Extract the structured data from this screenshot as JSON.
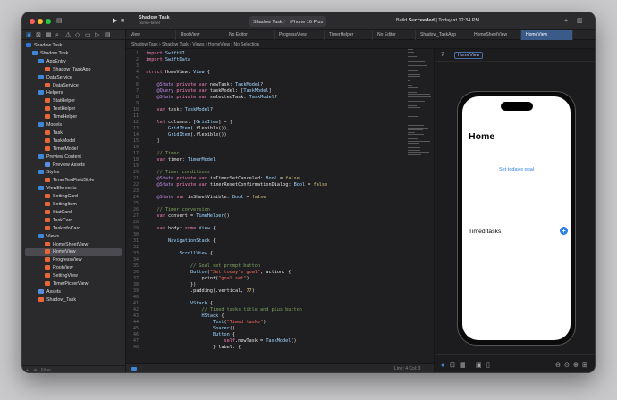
{
  "titlebar": {
    "project": "Shadow Task",
    "branch": "home-timer",
    "scheme": "Shadow Task",
    "device": "iPhone 16 Plus",
    "status_prefix": "Build ",
    "status_bold": "Succeeded",
    "status_time": " | Today at 12:34 PM"
  },
  "tabs": [
    "View",
    "RootView",
    "No Editor",
    "ProgressView",
    "TimerHelper",
    "No Editor",
    "Shadow_TaskApp",
    "HomeSheetView",
    "HomeView"
  ],
  "breadcrumb": [
    "Shadow Task",
    "Shadow Task",
    "Views",
    "HomeView",
    "No Selection"
  ],
  "navigator": [
    {
      "label": "Shadow Task",
      "kind": "proj",
      "level": 0
    },
    {
      "label": "Shadow Task",
      "kind": "folder",
      "level": 1
    },
    {
      "label": "AppEntry",
      "kind": "folder",
      "level": 2
    },
    {
      "label": "Shadow_TaskApp",
      "kind": "swift",
      "level": 3
    },
    {
      "label": "DataService",
      "kind": "folder",
      "level": 2
    },
    {
      "label": "DataService",
      "kind": "swift",
      "level": 3
    },
    {
      "label": "Helpers",
      "kind": "folder",
      "level": 2
    },
    {
      "label": "StatHelper",
      "kind": "swift",
      "level": 3
    },
    {
      "label": "TextHelper",
      "kind": "swift",
      "level": 3
    },
    {
      "label": "TimeHelper",
      "kind": "swift",
      "level": 3
    },
    {
      "label": "Models",
      "kind": "folder",
      "level": 2
    },
    {
      "label": "Task",
      "kind": "swift",
      "level": 3
    },
    {
      "label": "TaskModel",
      "kind": "swift",
      "level": 3
    },
    {
      "label": "TimerModel",
      "kind": "swift",
      "level": 3
    },
    {
      "label": "Preview Content",
      "kind": "folder",
      "level": 2
    },
    {
      "label": "Preview Assets",
      "kind": "asset",
      "level": 3
    },
    {
      "label": "Styles",
      "kind": "folder",
      "level": 2
    },
    {
      "label": "TimerTextFieldStyle",
      "kind": "swift",
      "level": 3
    },
    {
      "label": "ViewElements",
      "kind": "folder",
      "level": 2
    },
    {
      "label": "SettingCard",
      "kind": "swift",
      "level": 3
    },
    {
      "label": "SettingItem",
      "kind": "swift",
      "level": 3
    },
    {
      "label": "StatCard",
      "kind": "swift",
      "level": 3
    },
    {
      "label": "TaskCard",
      "kind": "swift",
      "level": 3
    },
    {
      "label": "TaskInfoCard",
      "kind": "swift",
      "level": 3
    },
    {
      "label": "Views",
      "kind": "folder",
      "level": 2
    },
    {
      "label": "HomeSheetView",
      "kind": "swift",
      "level": 3
    },
    {
      "label": "HomeView",
      "kind": "swift",
      "level": 3,
      "selected": true
    },
    {
      "label": "ProgressView",
      "kind": "swift",
      "level": 3
    },
    {
      "label": "RootView",
      "kind": "swift",
      "level": 3
    },
    {
      "label": "SettingView",
      "kind": "swift",
      "level": 3
    },
    {
      "label": "TimerPickerView",
      "kind": "swift",
      "level": 3
    },
    {
      "label": "Assets",
      "kind": "asset",
      "level": 2
    },
    {
      "label": "Shadow_Task",
      "kind": "swift",
      "level": 2
    }
  ],
  "filter_placeholder": "Filter",
  "code_start": 1,
  "code": [
    "import SwiftUI",
    "import SwiftData",
    "",
    "struct HomeView: View {",
    "",
    "    @State private var newTask: TaskModel?",
    "    @Query private var taskModel: [TaskModel]",
    "    @State private var selectedTask: TaskModel?",
    "",
    "    var task: TaskModel?",
    "",
    "    let columns: [GridItem] = [",
    "        GridItem(.flexible()),",
    "        GridItem(.flexible())",
    "    ]",
    "",
    "    // Timer",
    "    var timer: TimerModel",
    "",
    "    // Timer conditions",
    "    @State private var isTimerSetCanceled: Bool = false",
    "    @State private var timerResetConfirmationDialog: Bool = false",
    "",
    "    @State var isSheetVisible: Bool = false",
    "",
    "    // Timer conversion",
    "    var convert = TimeHelper()",
    "",
    "    var body: some View {",
    "",
    "        NavigationStack {",
    "",
    "            ScrollView {",
    "",
    "                // Goal set prompt button",
    "                Button(\"Set today's goal\", action: {",
    "                    print(\"goal set\")",
    "                })",
    "                .padding(.vertical, 77)",
    "",
    "                VStack {",
    "                    // Timed tasks title and plus button",
    "                    HStack {",
    "                        Text(\"Timed tasks\")",
    "                        Spacer()",
    "                        Button {",
    "                            self.newTask = TaskModel()",
    "                        } label: {"
  ],
  "preview": {
    "badge": "HomeView",
    "title": "Home",
    "goal_button": "Set today's goal",
    "timed_tasks": "Timed tasks",
    "plus": "+"
  },
  "statusbar": {
    "cursor": "Line: 4  Col: 3"
  }
}
